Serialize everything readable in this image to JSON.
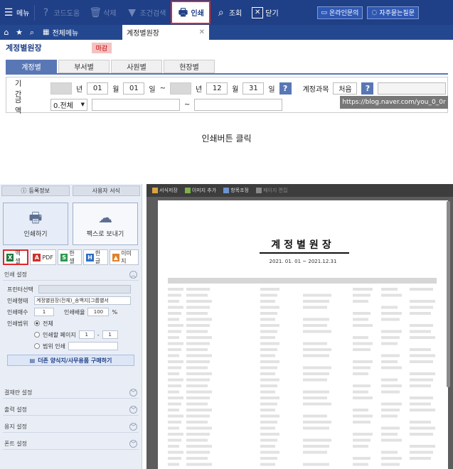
{
  "toolbar": {
    "menu": "메뉴",
    "code_help": "코드도움",
    "delete": "삭제",
    "condition_search": "조건검색",
    "print": "인쇄",
    "inquiry": "조회",
    "close": "닫기",
    "online_inquiry": "온라인문의",
    "faq": "자주묻는질문"
  },
  "tabs": {
    "all_menu": "전체메뉴",
    "active": "계정별원장"
  },
  "page": {
    "title": "계정별원장",
    "status_badge": "마감"
  },
  "subtabs": [
    "계정별",
    "부서별",
    "사원별",
    "현장별"
  ],
  "filter": {
    "period_label": "기 간",
    "year1_suffix": "년",
    "month1": "01",
    "month_suffix": "월",
    "day1": "01",
    "day_suffix": "일",
    "tilde": "~",
    "month2": "12",
    "day2": "31",
    "account_label": "계정과목",
    "account_value": "처음",
    "amount_label": "금 액",
    "amount_select": "0.전체"
  },
  "watermark": "https://blog.naver.com/you_0_0r",
  "caption": "인쇄버튼 클릭",
  "print_panel": {
    "tab_register": "등록정보",
    "tab_user_format": "사용자 서식",
    "print_button": "인쇄하기",
    "fax_button": "팩스로 보내기",
    "formats": [
      {
        "label": "엑셀",
        "color": "#1e7a3c",
        "glyph": "X"
      },
      {
        "label": "PDF",
        "color": "#d0312d",
        "glyph": "A"
      },
      {
        "label": "한셀",
        "color": "#2e9a52",
        "glyph": "S"
      },
      {
        "label": "한글",
        "color": "#2f6fc6",
        "glyph": "H"
      },
      {
        "label": "이미지",
        "color": "#e0822a",
        "glyph": "▲"
      }
    ],
    "print_settings": "인쇄 설정",
    "printer_select": "프린터선택",
    "print_type": "인쇄형태",
    "print_type_value": "계정별원장(전체)_송백지[그룹별서",
    "copies_label": "인쇄매수",
    "copies_value": "1",
    "scale_label": "인쇄배율",
    "scale_value": "100",
    "percent": "%",
    "range_label": "인쇄범위",
    "range_all": "전체",
    "range_pages": "인쇄할 페이지",
    "range_from": "1",
    "range_to": "1",
    "range_dash": "-",
    "range_partial": "범위 인쇄",
    "buy_forms": "더존 양식지/사무용품 구매하기",
    "sections": [
      "결재란 설정",
      "출력 설정",
      "용지 설정",
      "폰트 설정"
    ]
  },
  "viewer": {
    "tools": [
      "서식저장",
      "이미지 추가",
      "항목조정",
      "페이지 편집"
    ],
    "doc_title": "계정별원장",
    "doc_period": "2021. 01. 01 ~ 2021.12.31"
  }
}
